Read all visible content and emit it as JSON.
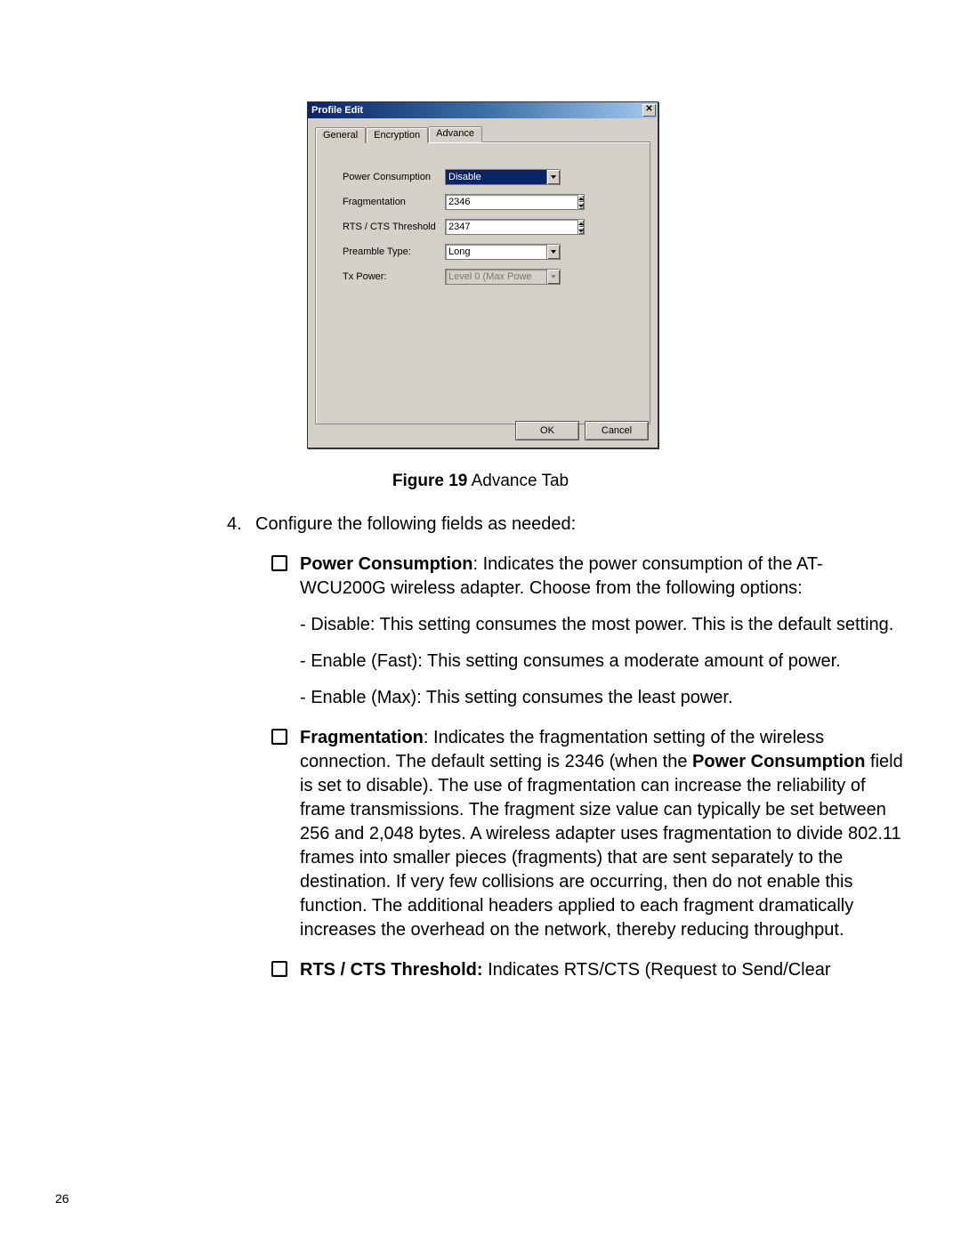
{
  "dialog": {
    "title": "Profile Edit",
    "tabs": {
      "general": "General",
      "encryption": "Encryption",
      "advance": "Advance"
    },
    "fields": {
      "power_consumption": {
        "label": "Power Consumption",
        "value": "Disable"
      },
      "fragmentation": {
        "label": "Fragmentation",
        "value": "2346"
      },
      "rts_cts": {
        "label": "RTS / CTS Threshold",
        "value": "2347"
      },
      "preamble": {
        "label": "Preamble Type:",
        "value": "Long"
      },
      "tx_power": {
        "label": "Tx Power:",
        "value": "Level 0 (Max Powe"
      }
    },
    "buttons": {
      "ok": "OK",
      "cancel": "Cancel"
    }
  },
  "figure": {
    "label": "Figure 19",
    "caption": "  Advance Tab"
  },
  "step": {
    "num": "4.",
    "text": "Configure the following fields as needed:"
  },
  "bullets": {
    "pc": {
      "term": "Power Consumption",
      "rest": ": Indicates the power consumption of the AT-WCU200G wireless adapter. Choose from the following options:",
      "sub1": "- Disable: This setting consumes the most power. This is the default setting.",
      "sub2": "- Enable (Fast): This setting consumes a moderate amount of power.",
      "sub3": "- Enable (Max): This setting consumes the least power."
    },
    "frag": {
      "term": "Fragmentation",
      "rest_a": ": Indicates the fragmentation setting of the wireless connection. The default setting is 2346 (when the ",
      "rest_bold": "Power Consumption",
      "rest_b": " field is set to disable). The use of fragmentation can increase the reliability of frame transmissions. The fragment size value can typically be set between 256 and 2,048 bytes. A wireless adapter uses fragmentation to divide 802.11 frames into smaller pieces (fragments) that are sent separately to the destination. If very few collisions are occurring, then do not enable this function. The additional headers applied to each fragment dramatically increases the overhead on the network, thereby reducing throughput."
    },
    "rts": {
      "term": "RTS / CTS Threshold:",
      "rest": " Indicates RTS/CTS (Request to Send/Clear"
    }
  },
  "page_number": "26"
}
